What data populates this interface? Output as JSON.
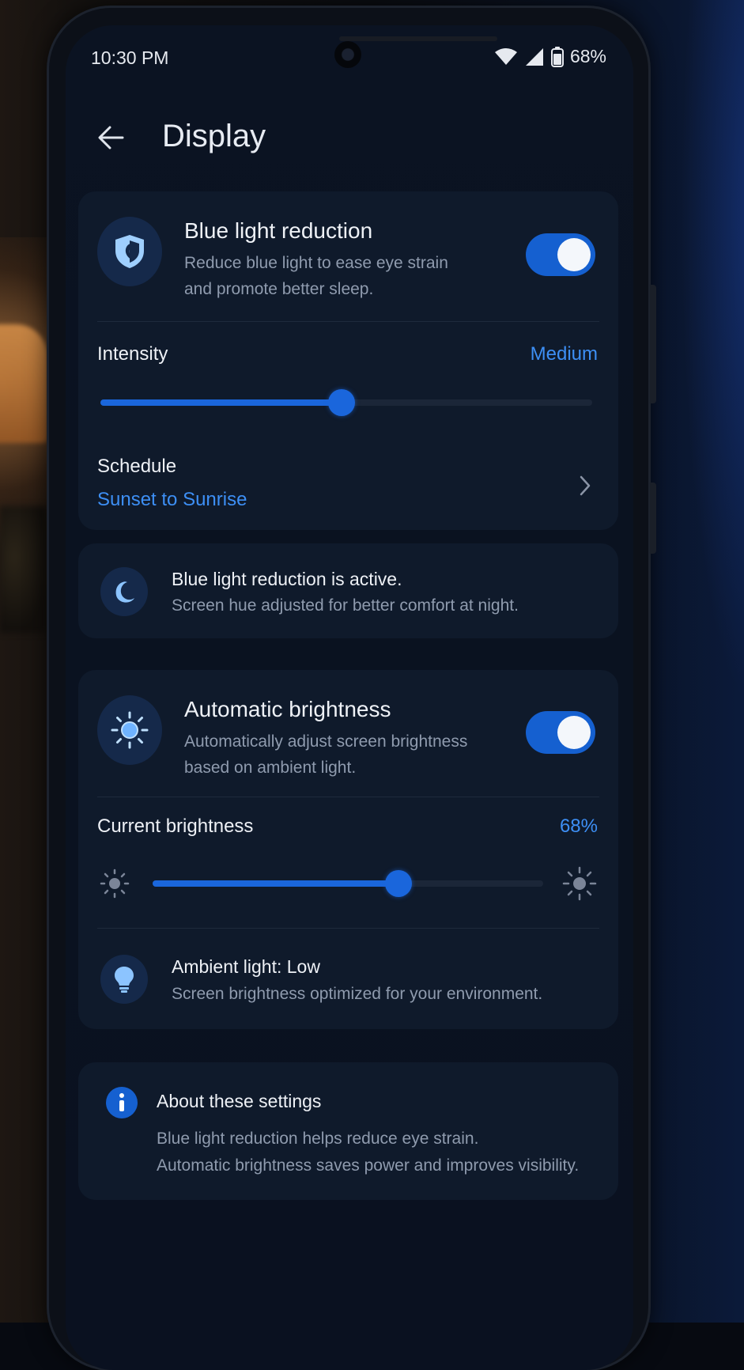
{
  "status_bar": {
    "time": "10:30 PM",
    "battery": "68%"
  },
  "header": {
    "title": "Display"
  },
  "blue_light": {
    "title": "Blue light reduction",
    "description_line1": "Reduce blue light to ease eye strain",
    "description_line2": "and promote better sleep.",
    "enabled": true,
    "intensity_label": "Intensity",
    "intensity_value": "Medium",
    "intensity_level": 0.49,
    "schedule_label": "Schedule",
    "schedule_value": "Sunset to Sunrise"
  },
  "active_notice": {
    "title": "Blue light reduction is active.",
    "subtitle": "Screen hue adjusted for better comfort at night."
  },
  "auto_brightness": {
    "title": "Automatic brightness",
    "description_line1": "Automatically adjust screen brightness",
    "description_line2": "based on ambient light.",
    "enabled": true,
    "current_label": "Current brightness",
    "current_value": "68%",
    "brightness_level": 0.63,
    "ambient_title": "Ambient light: Low",
    "ambient_subtitle": "Screen brightness optimized for your environment."
  },
  "about": {
    "title": "About these settings",
    "line1": "Blue light reduction helps reduce eye strain.",
    "line2": "Automatic brightness saves power and improves visibility."
  },
  "colors": {
    "accent": "#1a66dc",
    "accent_text": "#3d8ff5",
    "card": "#0f1a2b",
    "background": "#0a1220"
  }
}
